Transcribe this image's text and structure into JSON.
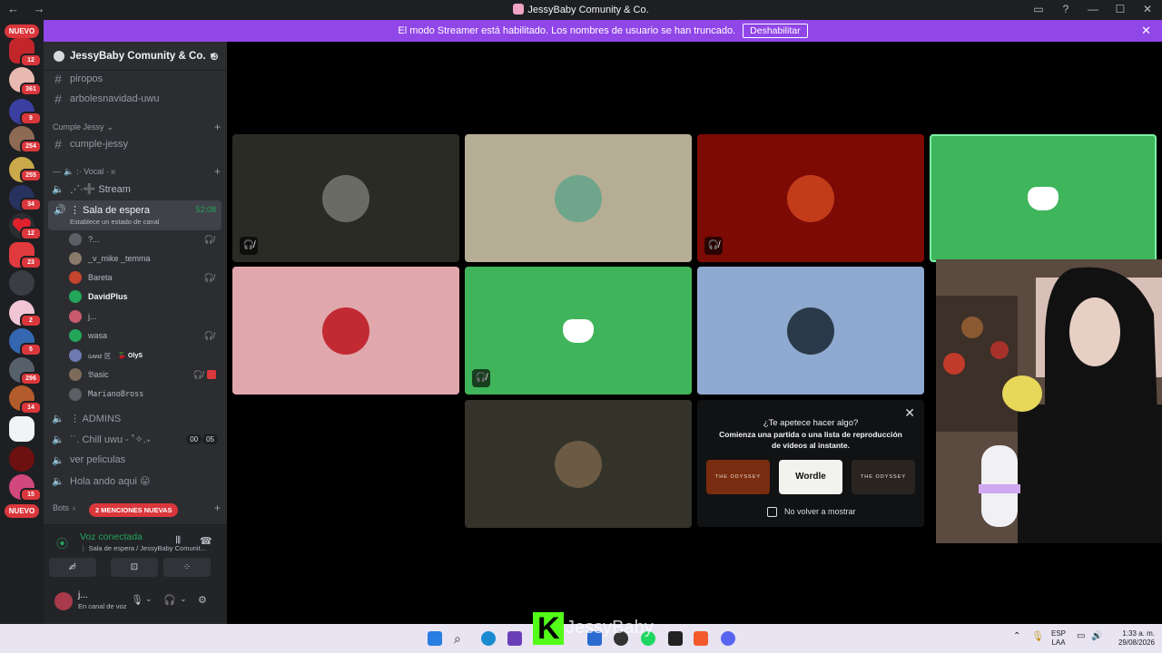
{
  "window": {
    "title": "JessyBaby Comunity & Co.",
    "nav_back": "←",
    "nav_forward": "→",
    "controls": [
      "▭",
      "?",
      "—",
      "☐",
      "✕"
    ]
  },
  "banner": {
    "text": "El modo Streamer está habilitado. Los nombres de usuario se han truncado.",
    "button": "Deshabilitar",
    "close": "✕"
  },
  "rail": {
    "new_top": "NUEVO",
    "new_bottom": "NUEVO",
    "badges": [
      "12",
      "361",
      "9",
      "254",
      "255",
      "34",
      "12",
      "23",
      "2",
      "5",
      "296",
      "14",
      "15"
    ]
  },
  "sidebar": {
    "server_name": "JessyBaby Comunity & Co.",
    "channels": {
      "piropos": "piropos",
      "arboles": "arbolesnavidad-uwu",
      "cumple_cat": "Cumple Jessy",
      "cumple": "cumple-jessy",
      "vocal_cat": ":· Vocal · ೫",
      "stream": "⋰·➕ Stream",
      "sala": "⋮ Sala de espera",
      "sala_timer": "52:08",
      "sala_status": "Establece un estado de canal",
      "admins": "⋮ ADMINS",
      "chill": "ʿ˙. Chill uwu - ˚✧.₊",
      "chill_a": "00",
      "chill_b": "05",
      "peliculas": "ver peliculas",
      "hola": "Hola ando aqui 😛",
      "bots_cat": "Bots",
      "mentions": "2 MENCIONES NUEVAS"
    },
    "members": [
      {
        "name": "?...",
        "color": "#5c5f66"
      },
      {
        "name": "_v_mike _temma",
        "color": "#8a7a6a"
      },
      {
        "name": "Bareta",
        "color": "#c4442c"
      },
      {
        "name": "DavidPlus",
        "color": "#23a55a"
      },
      {
        "name": "j...",
        "color": "#c9596e"
      },
      {
        "name": "wasa",
        "color": "#23a55a"
      },
      {
        "name": "ɢᴀɴᴢ 区",
        "color": "#6d7bb0"
      },
      {
        "name": "𝔅asic",
        "color": "#7c6a5a"
      },
      {
        "name": "MarianoBross",
        "color": "#5b5e63"
      }
    ],
    "ganz_tag": "🍒 OlyS",
    "voice": {
      "title": "Voz conectada",
      "sub": "⋮ Sala de espera / JessyBaby Comunit...",
      "user": "j...",
      "user_sub": "En canal de voz"
    }
  },
  "activity": {
    "question": "¿Te apetece hacer algo?",
    "desc1": "Comienza una partida o una lista de reproducción",
    "desc2": "de vídeos al instante.",
    "cards": [
      "THE ODYSSEY",
      "Wordle",
      "THE ODYSSEY"
    ],
    "checkbox": "No volver a mostrar"
  },
  "tiles": [
    {
      "bg": "#2a2b24",
      "av": "#6b6b65"
    },
    {
      "bg": "#b5ae95",
      "av": "#6fa58a"
    },
    {
      "bg": "#7d0a05",
      "av": "#c23c1a"
    },
    {
      "bg": "#3fb55c"
    },
    {
      "bg": "#e0a8ac",
      "av": "#c22a33"
    },
    {
      "bg": "#40b45a"
    },
    {
      "bg": "#8faad0",
      "av": "#2b3a4a"
    },
    {
      "bg": "#34332a",
      "av": "#6b5b44"
    }
  ],
  "taskbar": {
    "lang1": "ESP",
    "lang2": "LAA",
    "time": "1:33 a. m.",
    "date": "29/08/2026",
    "stream_name": "JessyBaby"
  }
}
